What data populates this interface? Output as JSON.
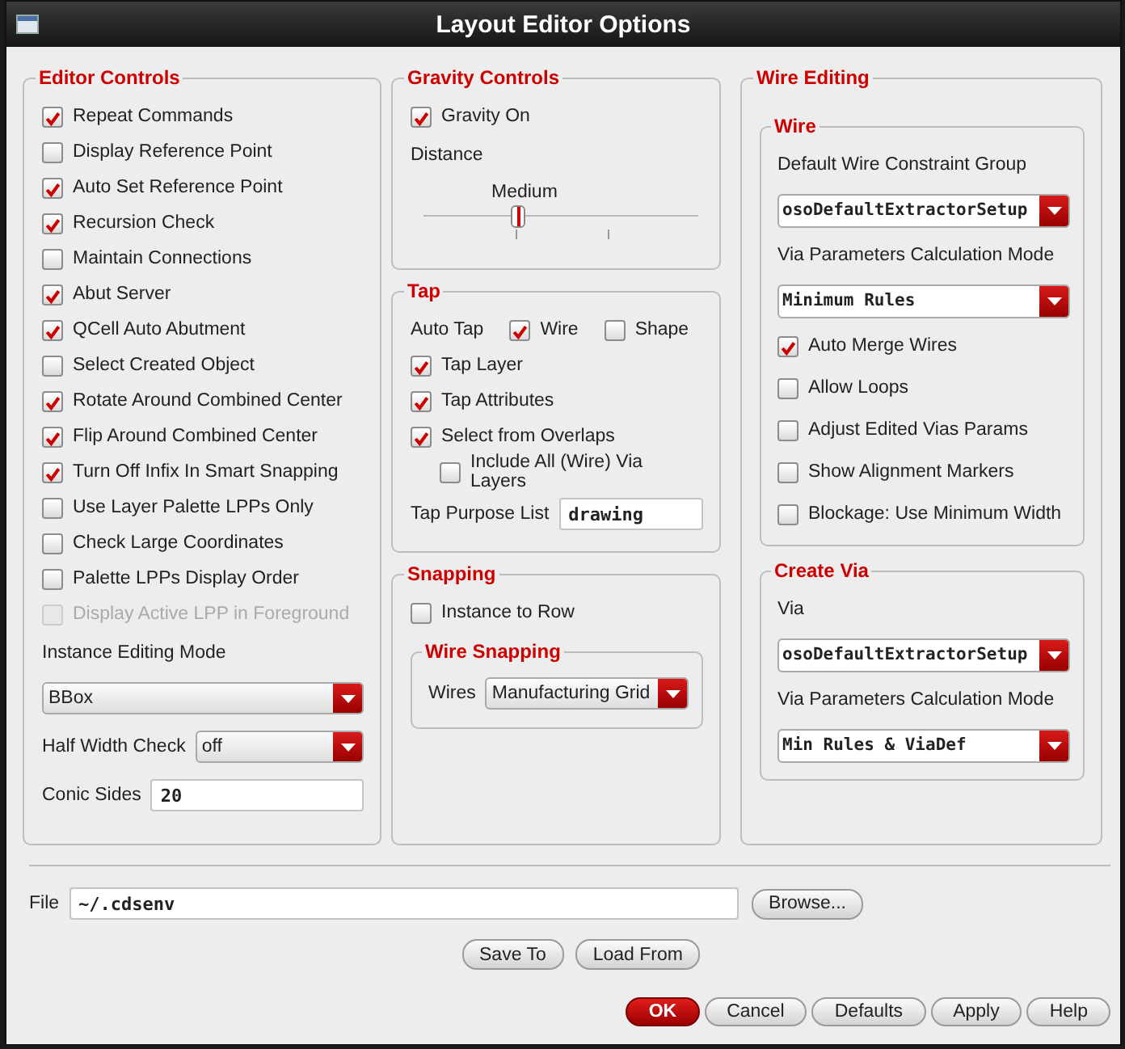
{
  "window": {
    "title": "Layout Editor Options"
  },
  "columns": [
    [
      {
        "title": "Editor Controls",
        "items": [
          {
            "kind": "checkbox",
            "label": "Repeat Commands",
            "checked": true,
            "disabled": false
          },
          {
            "kind": "checkbox",
            "label": "Display Reference Point",
            "checked": false,
            "disabled": false
          },
          {
            "kind": "checkbox",
            "label": "Auto Set Reference Point",
            "checked": true,
            "disabled": false
          },
          {
            "kind": "checkbox",
            "label": "Recursion Check",
            "checked": true,
            "disabled": false
          },
          {
            "kind": "checkbox",
            "label": "Maintain Connections",
            "checked": false,
            "disabled": false
          },
          {
            "kind": "checkbox",
            "label": "Abut Server",
            "checked": true,
            "disabled": false
          },
          {
            "kind": "checkbox",
            "label": "QCell Auto Abutment",
            "checked": true,
            "disabled": false
          },
          {
            "kind": "checkbox",
            "label": "Select Created Object",
            "checked": false,
            "disabled": false
          },
          {
            "kind": "checkbox",
            "label": "Rotate Around Combined Center",
            "checked": true,
            "disabled": false
          },
          {
            "kind": "checkbox",
            "label": "Flip Around Combined Center",
            "checked": true,
            "disabled": false
          },
          {
            "kind": "checkbox",
            "label": "Turn Off Infix In Smart Snapping",
            "checked": true,
            "disabled": false
          },
          {
            "kind": "checkbox",
            "label": "Use Layer Palette LPPs Only",
            "checked": false,
            "disabled": false
          },
          {
            "kind": "checkbox",
            "label": "Check Large Coordinates",
            "checked": false,
            "disabled": false
          },
          {
            "kind": "checkbox",
            "label": "Palette LPPs Display Order",
            "checked": false,
            "disabled": false
          },
          {
            "kind": "checkbox",
            "label": "Display Active LPP in Foreground",
            "checked": false,
            "disabled": true
          },
          {
            "kind": "label",
            "text": "Instance Editing Mode"
          },
          {
            "kind": "dropdown",
            "value": "BBox"
          },
          {
            "kind": "dropdown",
            "label": "Half Width Check",
            "value": "off"
          },
          {
            "kind": "field",
            "label": "Conic Sides",
            "value": "20"
          }
        ]
      }
    ],
    [
      {
        "title": "Gravity Controls",
        "items": [
          {
            "kind": "checkbox",
            "label": "Gravity On",
            "checked": true
          },
          {
            "kind": "label",
            "text": "Distance"
          },
          {
            "kind": "slider",
            "label": "Medium",
            "level": 0.34
          }
        ]
      },
      {
        "title": "Tap",
        "items": [
          {
            "kind": "checkrow",
            "label": "Auto Tap",
            "options": [
              {
                "label": "Wire",
                "checked": true
              },
              {
                "label": "Shape",
                "checked": false
              }
            ]
          },
          {
            "kind": "checkbox",
            "label": "Tap Layer",
            "checked": true
          },
          {
            "kind": "checkbox",
            "label": "Tap Attributes",
            "checked": true
          },
          {
            "kind": "checkbox",
            "label": "Select from Overlaps",
            "checked": true,
            "children": [
              {
                "kind": "checkbox",
                "label": "Include All (Wire) Via Layers",
                "checked": false
              }
            ]
          },
          {
            "kind": "field",
            "label": "Tap Purpose List",
            "value": "drawing"
          }
        ]
      },
      {
        "title": "Snapping",
        "items": [
          {
            "kind": "checkbox",
            "label": "Instance to Row",
            "checked": false
          },
          {
            "kind": "group",
            "title": "Wire Snapping",
            "items": [
              {
                "kind": "dropdown",
                "label": "Wires",
                "value": "Manufacturing Grid"
              }
            ]
          }
        ]
      }
    ],
    [
      {
        "title": "Wire Editing",
        "items": [
          {
            "kind": "group",
            "title": "Wire",
            "items": [
              {
                "kind": "label",
                "text": "Default Wire Constraint Group"
              },
              {
                "kind": "combo",
                "value": "osoDefaultExtractorSetup"
              },
              {
                "kind": "label",
                "text": "Via Parameters Calculation Mode"
              },
              {
                "kind": "combo",
                "value": "Minimum Rules"
              },
              {
                "kind": "checkbox",
                "label": "Auto Merge Wires",
                "checked": true
              },
              {
                "kind": "checkbox",
                "label": "Allow Loops",
                "checked": false
              },
              {
                "kind": "checkbox",
                "label": "Adjust Edited Vias Params",
                "checked": false
              },
              {
                "kind": "checkbox",
                "label": "Show Alignment Markers",
                "checked": false
              },
              {
                "kind": "checkbox",
                "label": "Blockage: Use Minimum Width",
                "checked": false
              }
            ]
          },
          {
            "kind": "group",
            "title": "Create Via",
            "items": [
              {
                "kind": "label",
                "text": "Via"
              },
              {
                "kind": "combo",
                "value": "osoDefaultExtractorSetup"
              },
              {
                "kind": "label",
                "text": "Via Parameters Calculation Mode"
              },
              {
                "kind": "combo",
                "value": "Min Rules & ViaDef"
              }
            ]
          }
        ]
      }
    ]
  ],
  "file": {
    "label": "File",
    "value": "~/.cdsenv",
    "browse": "Browse..."
  },
  "file_buttons": [
    "Save To",
    "Load From"
  ],
  "buttons": [
    {
      "label": "OK",
      "default": true
    },
    {
      "label": "Cancel",
      "default": false
    },
    {
      "label": "Defaults",
      "default": false
    },
    {
      "label": "Apply",
      "default": false
    },
    {
      "label": "Help",
      "default": false
    }
  ]
}
